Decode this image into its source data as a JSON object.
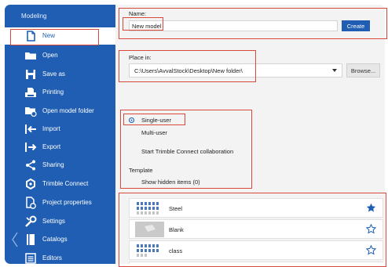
{
  "sidebar": {
    "title": "Modeling",
    "items": [
      {
        "label": "New",
        "icon": "new-file-icon",
        "active": true
      },
      {
        "label": "Open",
        "icon": "folder-icon"
      },
      {
        "label": "Save as",
        "icon": "save-icon"
      },
      {
        "label": "Printing",
        "icon": "printer-icon"
      },
      {
        "label": "Open model folder",
        "icon": "folder-gear-icon"
      },
      {
        "label": "Import",
        "icon": "import-icon"
      },
      {
        "label": "Export",
        "icon": "export-icon"
      },
      {
        "label": "Sharing",
        "icon": "share-icon"
      },
      {
        "label": "Trimble Connect",
        "icon": "trimble-connect-icon"
      },
      {
        "label": "Project properties",
        "icon": "project-properties-icon"
      },
      {
        "label": "Settings",
        "icon": "settings-icon"
      },
      {
        "label": "Catalogs",
        "icon": "catalog-icon"
      },
      {
        "label": "Editors",
        "icon": "editors-icon"
      }
    ]
  },
  "form": {
    "name_label": "Name:",
    "name_value": "New model",
    "create_label": "Create",
    "place_label": "Place in:",
    "place_value": "C:\\Users\\AvvalStock\\Desktop\\New folder\\",
    "browse_label": "Browse...",
    "single_user_label": "Single-user",
    "multi_user_label": "Multi-user",
    "single_user_selected": true,
    "trimble_collab_label": "Start Trimble Connect collaboration",
    "template_label": "Template",
    "show_hidden_label": "Show hidden items (0)"
  },
  "templates": [
    {
      "name": "Steel",
      "favorite": true
    },
    {
      "name": "Blank",
      "favorite": false
    },
    {
      "name": "class",
      "favorite": false
    }
  ],
  "colors": {
    "sidebar": "#1f5eb3",
    "accent": "#1f5eb3",
    "highlight": "#d9493b"
  }
}
